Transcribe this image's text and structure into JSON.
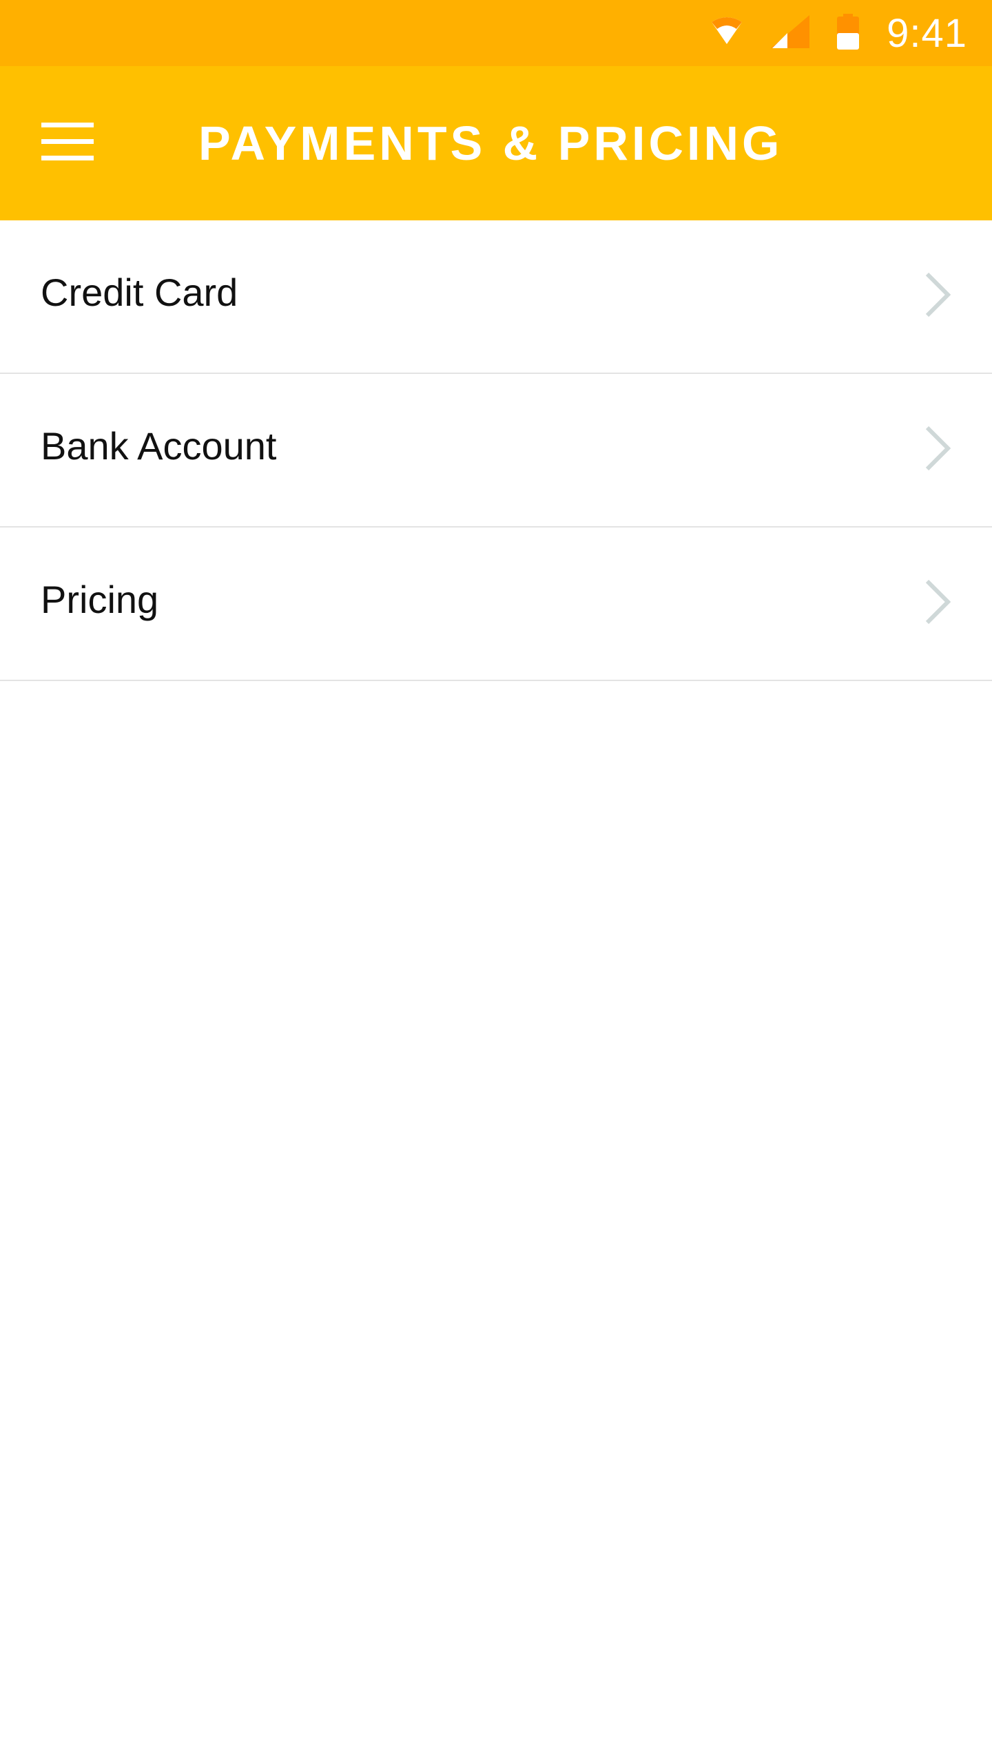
{
  "status_bar": {
    "time": "9:41",
    "icons": [
      "wifi-icon",
      "cell-signal-icon",
      "battery-icon"
    ],
    "background": "#FFB000"
  },
  "app_bar": {
    "title": "PAYMENTS & PRICING",
    "menu_icon": "hamburger-menu-icon",
    "background": "#FFC000"
  },
  "menu": {
    "items": [
      {
        "label": "Credit Card",
        "icon": "chevron-right-icon"
      },
      {
        "label": "Bank Account",
        "icon": "chevron-right-icon"
      },
      {
        "label": "Pricing",
        "icon": "chevron-right-icon"
      }
    ]
  },
  "colors": {
    "divider": "#E3E3E3",
    "chevron": "#CFD8D8",
    "text": "#111111"
  }
}
